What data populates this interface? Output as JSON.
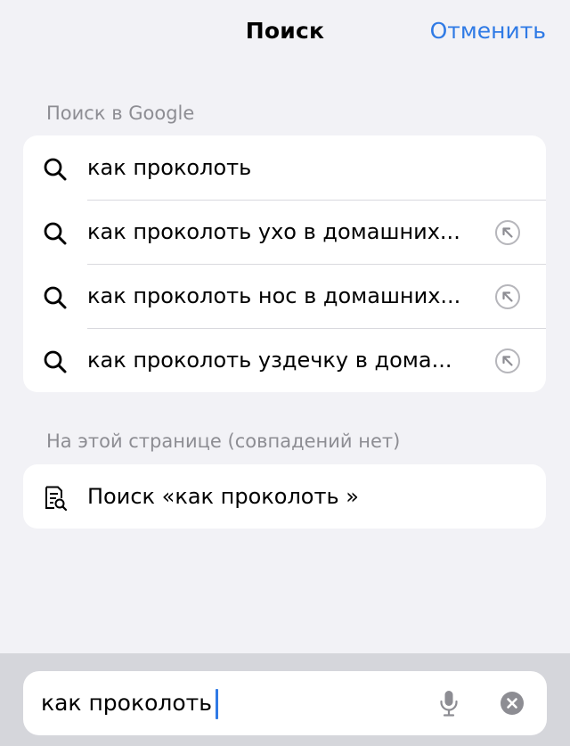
{
  "header": {
    "title": "Поиск",
    "cancel_label": "Отменить"
  },
  "google_section": {
    "label": "Поиск в Google",
    "suggestions": [
      {
        "text": "как проколоть",
        "icon": "search-icon",
        "has_fill_arrow": false
      },
      {
        "text": "как проколоть ухо в домашних...",
        "icon": "search-icon",
        "has_fill_arrow": true
      },
      {
        "text": "как проколоть нос в домашних...",
        "icon": "search-icon",
        "has_fill_arrow": true
      },
      {
        "text": "как проколоть уздечку в дома...",
        "icon": "search-icon",
        "has_fill_arrow": true
      }
    ]
  },
  "page_section": {
    "label": "На этой странице (совпадений нет)",
    "item": {
      "text": "Поиск «как проколоть »",
      "icon": "find-in-page-icon"
    }
  },
  "search_bar": {
    "value": "как проколоть",
    "mic_icon": "microphone-icon",
    "clear_icon": "clear-icon"
  },
  "colors": {
    "accent": "#2f7ae5",
    "background": "#f2f2f6",
    "secondary_text": "#8d8d93",
    "bottom_bar": "#d5d6db"
  }
}
